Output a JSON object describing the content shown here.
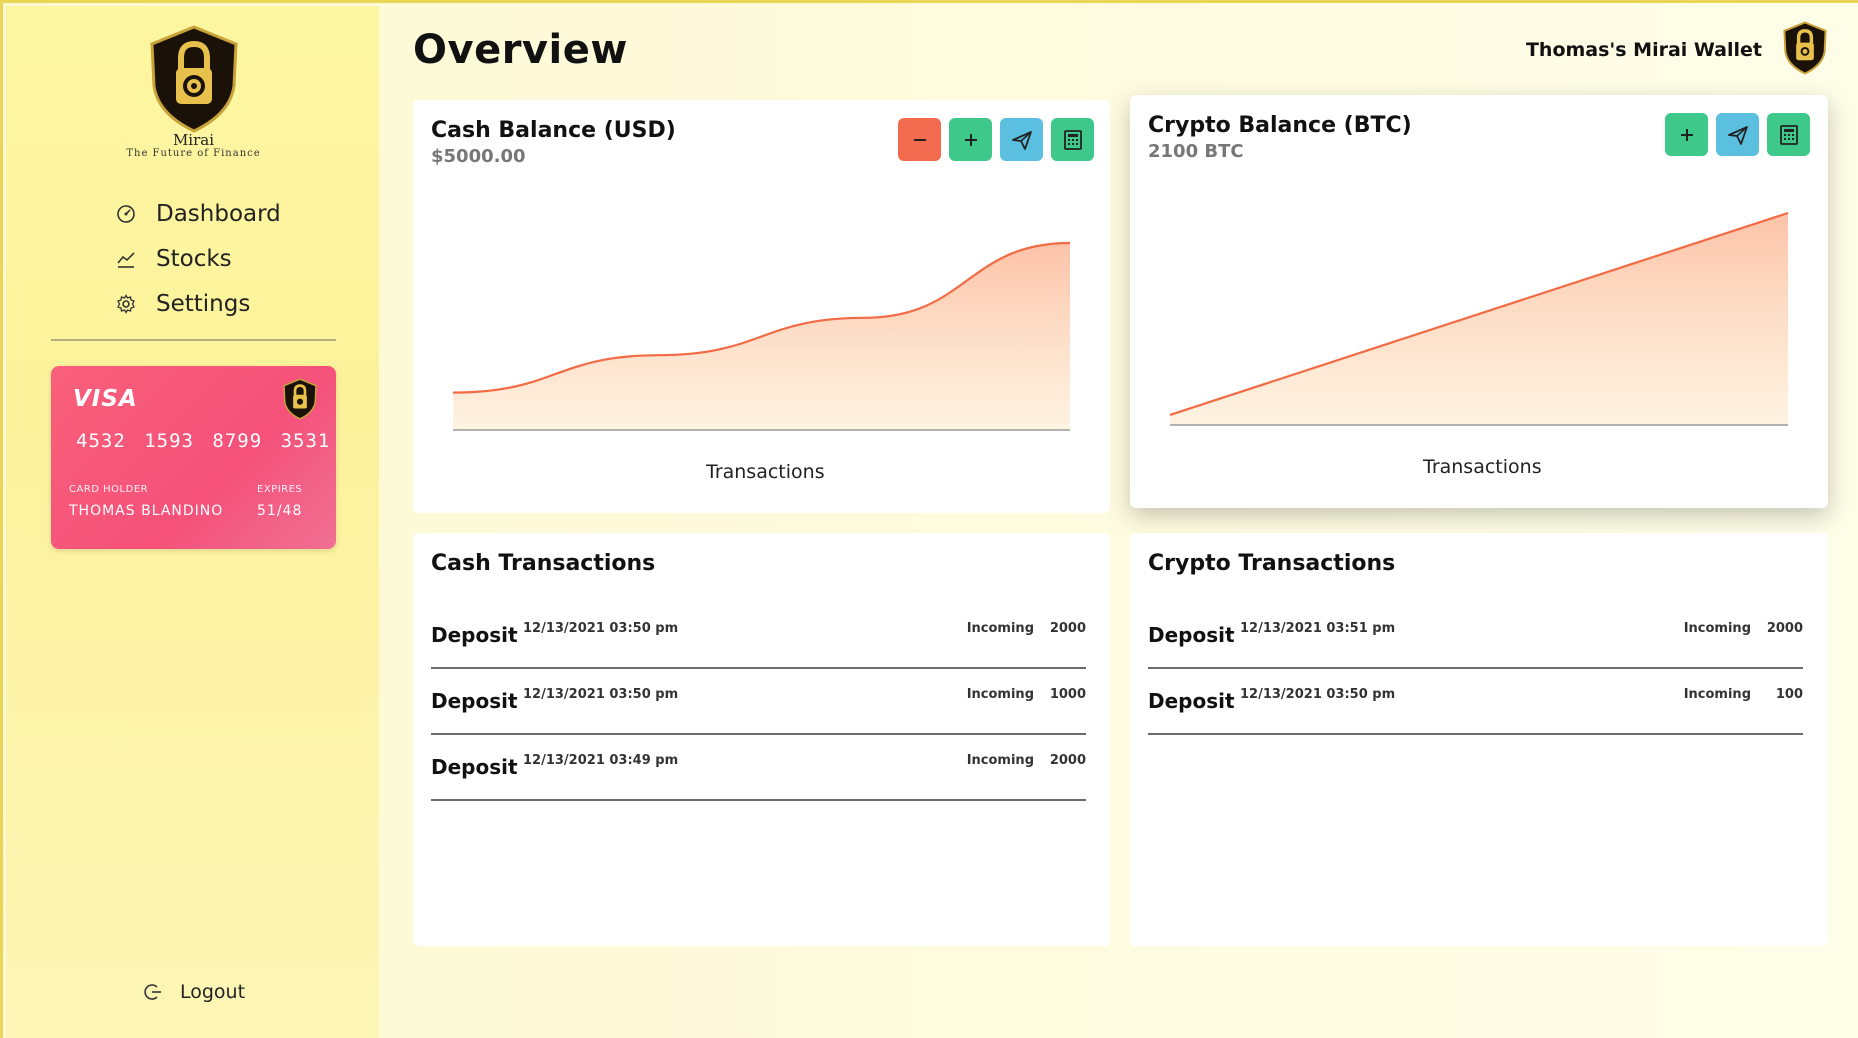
{
  "brand": {
    "name": "Mirai",
    "tagline": "The Future of Finance"
  },
  "sidebar": {
    "items": [
      {
        "label": "Dashboard",
        "icon": "speedometer-icon"
      },
      {
        "label": "Stocks",
        "icon": "line-chart-icon"
      },
      {
        "label": "Settings",
        "icon": "gear-icon"
      }
    ],
    "logout_label": "Logout"
  },
  "card": {
    "network": "VISA",
    "number": "4532 1593 8799 3531",
    "holder_label": "CARD HOLDER",
    "holder": "THOMAS BLANDINO",
    "expires_label": "EXPIRES",
    "expires": "51/48"
  },
  "header": {
    "title": "Overview",
    "wallet_name": "Thomas's Mirai Wallet"
  },
  "cash_balance": {
    "title": "Cash Balance (USD)",
    "amount": "$5000.00",
    "x_label": "Transactions"
  },
  "crypto_balance": {
    "title": "Crypto Balance (BTC)",
    "amount": "2100 BTC",
    "x_label": "Transactions"
  },
  "cash_transactions": {
    "title": "Cash Transactions",
    "rows": [
      {
        "type": "Deposit",
        "date": "12/13/2021 03:50 pm",
        "direction": "Incoming",
        "amount": "2000"
      },
      {
        "type": "Deposit",
        "date": "12/13/2021 03:50 pm",
        "direction": "Incoming",
        "amount": "1000"
      },
      {
        "type": "Deposit",
        "date": "12/13/2021 03:49 pm",
        "direction": "Incoming",
        "amount": "2000"
      }
    ]
  },
  "crypto_transactions": {
    "title": "Crypto Transactions",
    "rows": [
      {
        "type": "Deposit",
        "date": "12/13/2021 03:51 pm",
        "direction": "Incoming",
        "amount": "2000"
      },
      {
        "type": "Deposit",
        "date": "12/13/2021 03:50 pm",
        "direction": "Incoming",
        "amount": "100"
      }
    ]
  },
  "colors": {
    "accent_line": "#f26b45",
    "btn_red": "#f36b4e",
    "btn_green": "#3ec98b",
    "btn_blue": "#5bbfe0",
    "card": "#f5517a",
    "sidebar": "#fcf29c"
  },
  "chart_data": [
    {
      "type": "area",
      "x": [
        1,
        2,
        3,
        4
      ],
      "values": [
        1000,
        2000,
        3000,
        5000
      ],
      "xlabel": "Transactions",
      "ylabel": "",
      "ylim": [
        0,
        5000
      ],
      "grid": false
    },
    {
      "type": "area",
      "x": [
        1,
        2
      ],
      "values": [
        100,
        2100
      ],
      "xlabel": "Transactions",
      "ylabel": "",
      "ylim": [
        0,
        2100
      ],
      "grid": false
    }
  ]
}
